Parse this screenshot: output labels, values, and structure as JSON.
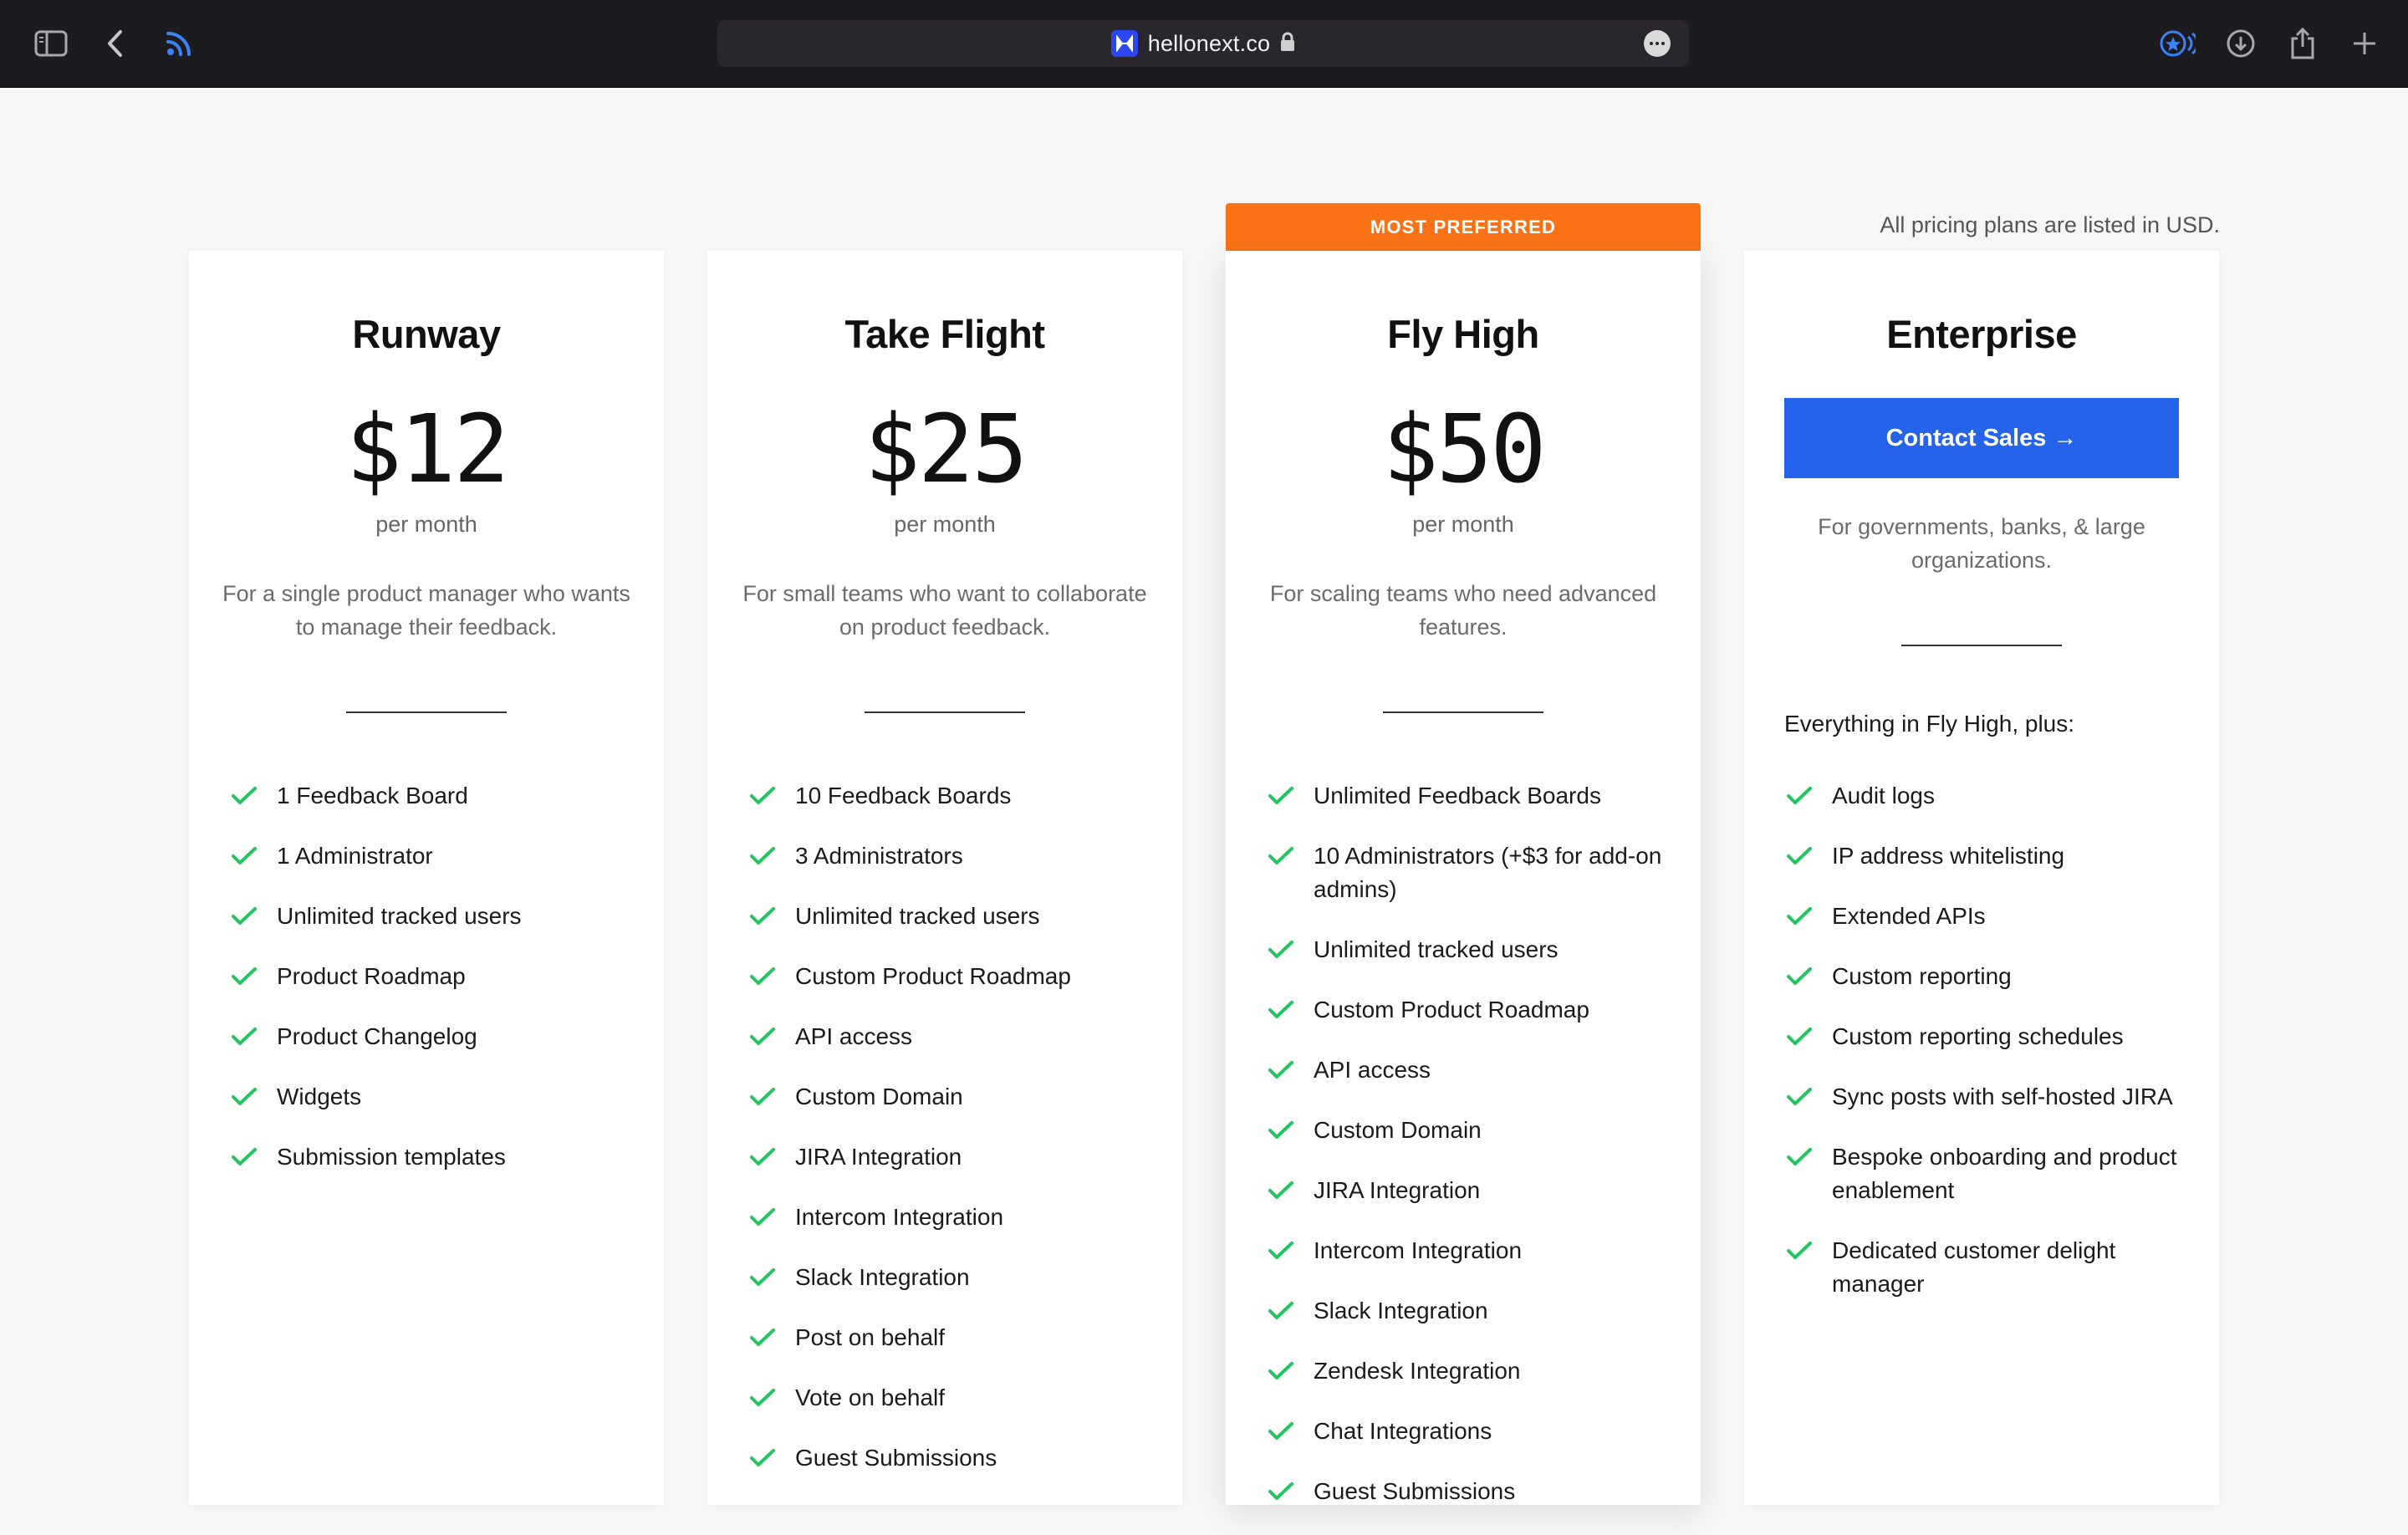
{
  "browser": {
    "url": "hellonext.co",
    "icons": [
      "sidebar-toggle-icon",
      "back-chevron-icon",
      "rss-feed-icon",
      "lock-icon",
      "more-options-icon",
      "privacy-report-icon",
      "download-icon",
      "share-icon",
      "new-tab-plus-icon"
    ]
  },
  "page": {
    "usd_note": "All pricing plans are listed in USD.",
    "featured_banner": "MOST PREFERRED",
    "accent_colors": {
      "check": "#22c55e",
      "banner": "#f97316",
      "cta": "#2563eb"
    }
  },
  "plans": [
    {
      "name": "Runway",
      "price": "$12",
      "period": "per month",
      "description": "For a single product manager who wants to manage their feedback.",
      "features": [
        "1 Feedback Board",
        "1 Administrator",
        "Unlimited tracked users",
        "Product Roadmap",
        "Product Changelog",
        "Widgets",
        "Submission templates"
      ]
    },
    {
      "name": "Take Flight",
      "price": "$25",
      "period": "per month",
      "description": "For small teams who want to collaborate on product feedback.",
      "features": [
        "10 Feedback Boards",
        "3 Administrators",
        "Unlimited tracked users",
        "Custom Product Roadmap",
        "API access",
        "Custom Domain",
        "JIRA Integration",
        "Intercom Integration",
        "Slack Integration",
        "Post on behalf",
        "Vote on behalf",
        "Guest Submissions"
      ]
    },
    {
      "name": "Fly High",
      "price": "$50",
      "period": "per month",
      "description": "For scaling teams who need advanced features.",
      "features": [
        "Unlimited Feedback Boards",
        "10 Administrators (+$3 for add-on admins)",
        "Unlimited tracked users",
        "Custom Product Roadmap",
        "API access",
        "Custom Domain",
        "JIRA Integration",
        "Intercom Integration",
        "Slack Integration",
        "Zendesk Integration",
        "Chat Integrations",
        "Guest Submissions"
      ]
    },
    {
      "name": "Enterprise",
      "cta": "Contact Sales →",
      "description": "For governments, banks, & large organizations.",
      "features_heading": "Everything in Fly High, plus:",
      "features": [
        "Audit logs",
        "IP address whitelisting",
        "Extended APIs",
        "Custom reporting",
        "Custom reporting schedules",
        "Sync posts with self-hosted JIRA",
        "Bespoke onboarding and product enablement",
        "Dedicated customer delight manager"
      ]
    }
  ]
}
